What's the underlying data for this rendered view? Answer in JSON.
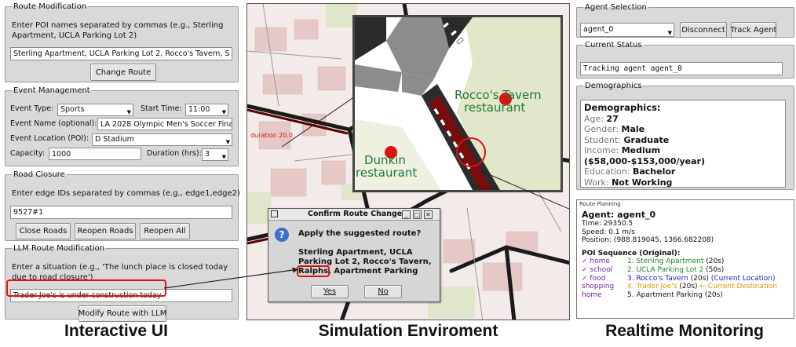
{
  "captions": {
    "left": "Interactive UI",
    "center": "Simulation Enviroment",
    "right": "Realtime Monitoring"
  },
  "route_modification": {
    "legend": "Route Modification",
    "instructions": "Enter POI names separated by commas (e.g., Sterling Apartment, UCLA Parking Lot 2)",
    "input_value": "Sterling Apartment, UCLA Parking Lot 2, Rocco's Tavern, S",
    "button": "Change Route"
  },
  "event_management": {
    "legend": "Event Management",
    "event_type_label": "Event Type:",
    "event_type_value": "Sports",
    "start_time_label": "Start Time:",
    "start_time_value": "11:00",
    "event_name_label": "Event Name (optional):",
    "event_name_value": "LA 2028 Olympic Men's Soccer Final",
    "event_location_label": "Event Location (POI):",
    "event_location_value": "D Stadium",
    "capacity_label": "Capacity:",
    "capacity_value": "1000",
    "duration_label": "Duration (hrs):",
    "duration_value": "3"
  },
  "road_closure": {
    "legend": "Road Closure",
    "instructions": "Enter edge IDs separated by commas (e.g., edge1,edge2)",
    "input_value": "9527#1",
    "close_button": "Close Roads",
    "reopen_button": "Reopen Roads",
    "reopen_all_button": "Reopen All"
  },
  "llm_route": {
    "legend": "LLM Route Modification",
    "instructions": "Enter a situation (e.g., 'The lunch place is closed today due to road closure')",
    "input_value": "Trader Joe's is under construction today",
    "button": "Modify Route with LLM"
  },
  "map": {
    "labels": [
      "Rocco's Tavern",
      "restaurant",
      "Dunkin",
      "restaurant",
      "duration 20.0"
    ],
    "accent_red": "#cc1111"
  },
  "dialog": {
    "title": "Confirm Route Change",
    "question": "Apply the suggested route?",
    "route_text_1": "Sterling Apartment, UCLA",
    "route_text_2": "Parking Lot 2, Rocco's Tavern,",
    "route_highlight": "Ralphs",
    "route_text_3": ", Apartment Parking",
    "yes": "Yes",
    "no": "No",
    "help_icon_glyph": "?"
  },
  "agent_selection": {
    "legend": "Agent Selection",
    "agent_value": "agent_0",
    "disconnect": "Disconnect",
    "track": "Track Agent"
  },
  "current_status": {
    "legend": "Current Status",
    "value": "Tracking agent agent_0"
  },
  "demographics": {
    "legend": "Demographics",
    "heading": "Demographics:",
    "rows": [
      {
        "label": "Age: ",
        "value": "27"
      },
      {
        "label": "Gender: ",
        "value": "Male"
      },
      {
        "label": "Student: ",
        "value": "Graduate"
      },
      {
        "label": "Income: ",
        "value": "Medium ($58,000-$153,000/year)"
      },
      {
        "label": "Education: ",
        "value": "Bachelor"
      },
      {
        "label": "Work: ",
        "value": "Not Working"
      }
    ]
  },
  "route_planning": {
    "legend": "Route Planning",
    "agent_line": "Agent: agent_0",
    "time_line": "Time: 29350.5",
    "speed_line": "Speed: 0.1 m/s",
    "position_line": "Position: (988.819045, 1366.682208)",
    "poi_heading": "POI Sequence (Original):",
    "poi": [
      {
        "tag": "✓ home",
        "text": "1.  Sterling Apartment",
        "dur": " (20s)",
        "note": "",
        "color": "#1f8a1f",
        "tagcolor": "#7a1fa2"
      },
      {
        "tag": "✓ school",
        "text": "2.  UCLA Parking Lot 2",
        "dur": " (50s)",
        "note": "",
        "color": "#1f8a1f",
        "tagcolor": "#7a1fa2"
      },
      {
        "tag": "✓ food",
        "text": "3.  Rocco's Tavern",
        "dur": " (20s)",
        "note": " (Current Location)",
        "color": "#1a1acc",
        "tagcolor": "#7a1fa2"
      },
      {
        "tag": "shopping",
        "text": "4.  Trader Joe's",
        "dur": " (20s)",
        "note": " ← Current Destination",
        "color": "#e69500",
        "tagcolor": "#7a1fa2"
      },
      {
        "tag": "home",
        "text": "5.  Apartment Parking",
        "dur": " (20s)",
        "note": "",
        "color": "#111111",
        "tagcolor": "#7a1fa2"
      }
    ]
  }
}
